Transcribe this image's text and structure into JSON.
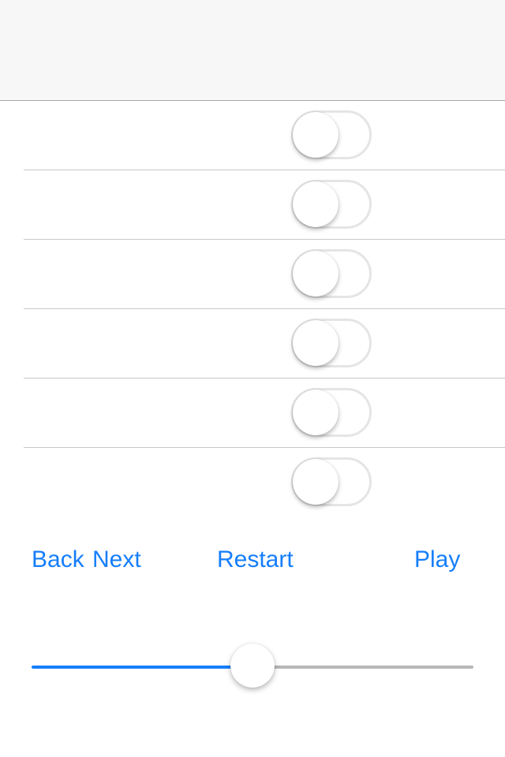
{
  "navbar": {
    "title": ""
  },
  "switches": [
    {
      "on": false
    },
    {
      "on": false
    },
    {
      "on": false
    },
    {
      "on": false
    },
    {
      "on": false
    },
    {
      "on": false
    }
  ],
  "toolbar": {
    "back_label": "Back",
    "next_label": "Next",
    "restart_label": "Restart",
    "play_label": "Play"
  },
  "slider": {
    "value": 0.5
  },
  "colors": {
    "accent": "#157efb",
    "track_inactive": "#b7b7b7",
    "switch_border_off": "#e5e5e5",
    "separator": "#c8c7cc",
    "navbar_background": "#f7f7f7"
  }
}
